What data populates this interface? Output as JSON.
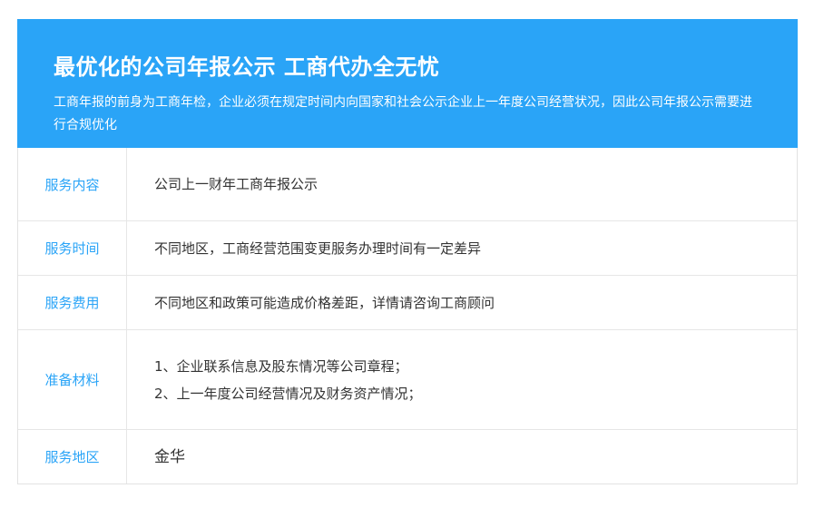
{
  "banner": {
    "title": "最优化的公司年报公示 工商代办全无忧",
    "description": "工商年报的前身为工商年检，企业必须在规定时间内向国家和社会公示企业上一年度公司经营状况，因此公司年报公示需要进行合规优化"
  },
  "rows": [
    {
      "label": "服务内容",
      "lines": [
        "公司上一财年工商年报公示"
      ]
    },
    {
      "label": "服务时间",
      "lines": [
        "不同地区，工商经营范围变更服务办理时间有一定差异"
      ]
    },
    {
      "label": "服务费用",
      "lines": [
        "不同地区和政策可能造成价格差距，详情请咨询工商顾问"
      ]
    },
    {
      "label": "准备材料",
      "lines": [
        "1、企业联系信息及股东情况等公司章程；",
        "2、上一年度公司经营情况及财务资产情况；"
      ]
    },
    {
      "label": "服务地区",
      "lines": [
        "金华"
      ]
    }
  ],
  "colors": {
    "accent": "#2aa4f7",
    "text": "#333333",
    "border": "#e6e6e6"
  }
}
